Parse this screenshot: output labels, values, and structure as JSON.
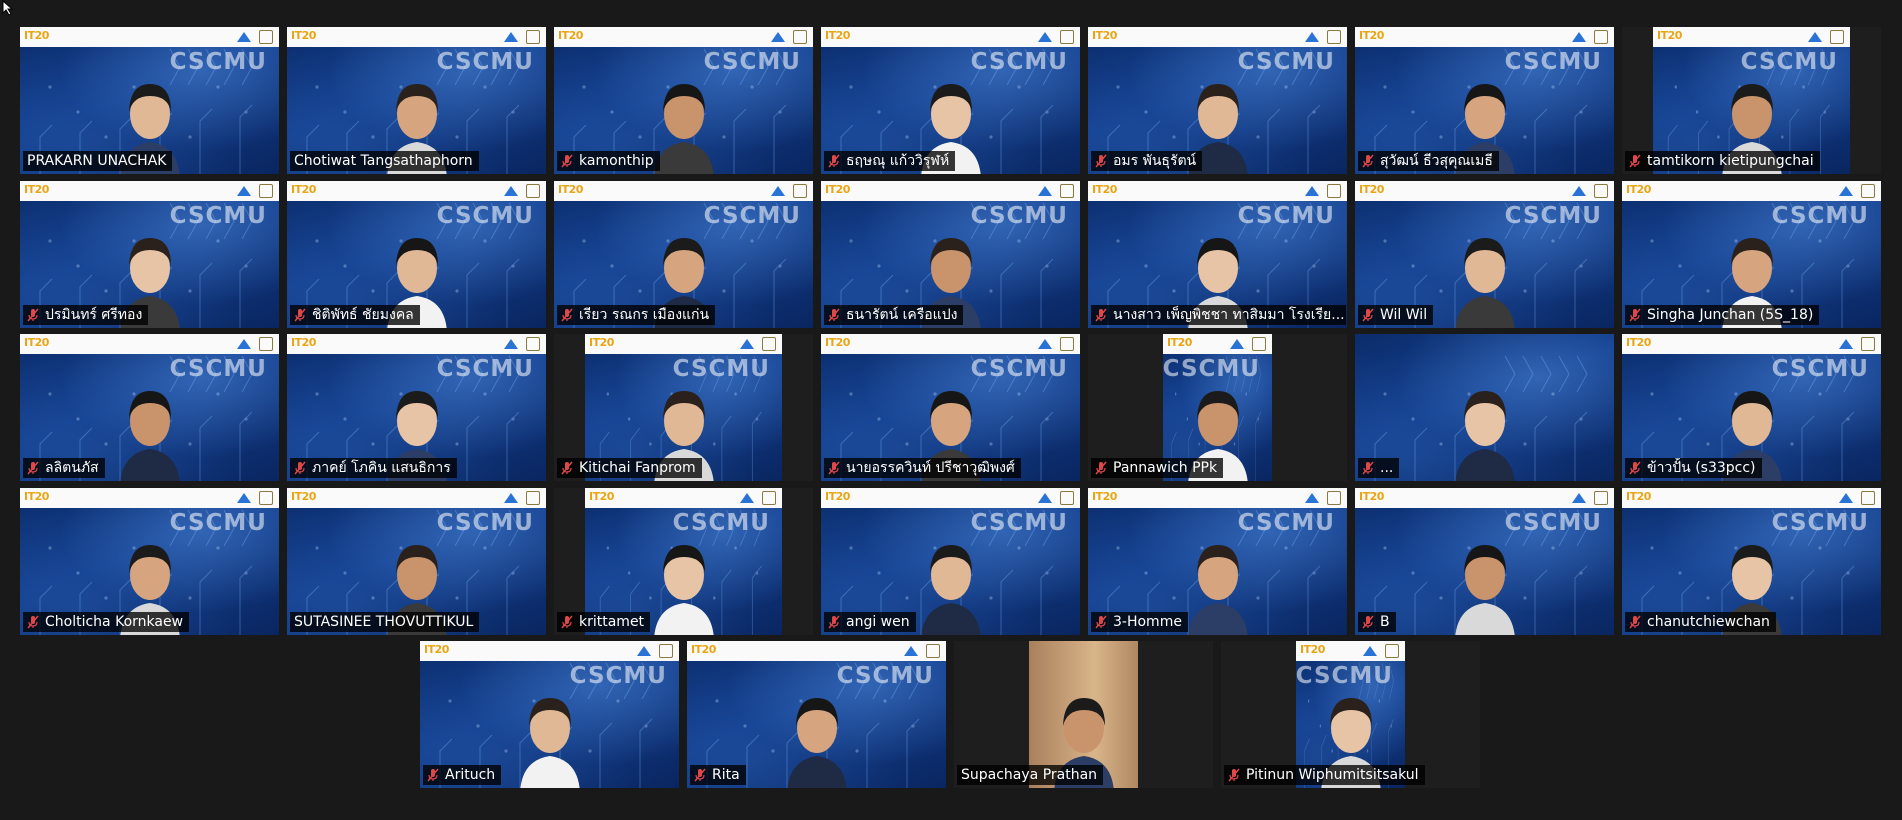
{
  "branding": {
    "brand_text": "IT20",
    "watermark_text": "CSCMU",
    "colors": {
      "background": "#191919",
      "video_blue": "#103c8c",
      "banner": "#fafafa",
      "muted_icon": "#e04848",
      "label_bg": "#000000"
    }
  },
  "participants": [
    {
      "name": "PRAKARN UNACHAK",
      "muted": false,
      "layout": "full",
      "banner": true
    },
    {
      "name": "Chotiwat Tangsathaphorn",
      "muted": false,
      "layout": "full",
      "banner": true
    },
    {
      "name": "kamonthip",
      "muted": true,
      "layout": "full",
      "banner": true
    },
    {
      "name": "ธฤษณุ แก้ววิรุฬห์",
      "muted": true,
      "layout": "full",
      "banner": true
    },
    {
      "name": "อมร พันธุรัตน์",
      "muted": true,
      "layout": "full",
      "banner": true
    },
    {
      "name": "สุวัฒน์ ธีวสุคุณเมธี",
      "muted": true,
      "layout": "full",
      "banner": true
    },
    {
      "name": "tamtikorn kietipungchai",
      "muted": true,
      "layout": "narrow",
      "banner": true
    },
    {
      "name": "ปรมินทร์ ศรีทอง",
      "muted": true,
      "layout": "full",
      "banner": true
    },
    {
      "name": "ชิติพัทธ์ ชัยมงคล",
      "muted": true,
      "layout": "full",
      "banner": true
    },
    {
      "name": "เรียว รณกร เมืองแก่น",
      "muted": true,
      "layout": "full",
      "banner": true
    },
    {
      "name": "ธนารัตน์ เครือแปง",
      "muted": true,
      "layout": "full",
      "banner": true
    },
    {
      "name": "นางสาว เพ็ญพิชชา ทาสิมมา โรงเรีย...",
      "muted": true,
      "layout": "full",
      "banner": true
    },
    {
      "name": "Wil Wil",
      "muted": true,
      "layout": "full",
      "banner": true
    },
    {
      "name": "Singha Junchan (5S_18)",
      "muted": true,
      "layout": "full",
      "banner": true
    },
    {
      "name": "ลลิตนภัส",
      "muted": true,
      "layout": "full",
      "banner": true
    },
    {
      "name": "ภาคย์ โภคิน แสนธิการ",
      "muted": true,
      "layout": "full",
      "banner": true
    },
    {
      "name": "Kitichai Fanprom",
      "muted": true,
      "layout": "narrow",
      "banner": true
    },
    {
      "name": "นายอรรควินท์ ปรีชาวุฒิพงศ์",
      "muted": true,
      "layout": "full",
      "banner": true
    },
    {
      "name": "Pannawich PPk",
      "muted": true,
      "layout": "narrow2",
      "banner": true
    },
    {
      "name": "...",
      "muted": true,
      "layout": "full",
      "banner": false
    },
    {
      "name": "ข้าวปั้น (s33pcc)",
      "muted": true,
      "layout": "full",
      "banner": true
    },
    {
      "name": "Cholticha Kornkaew",
      "muted": true,
      "layout": "full",
      "banner": true
    },
    {
      "name": "SUTASINEE THOVUTTIKUL",
      "muted": false,
      "layout": "full",
      "banner": true
    },
    {
      "name": "krittamet",
      "muted": true,
      "layout": "narrow",
      "banner": true
    },
    {
      "name": "angi wen",
      "muted": true,
      "layout": "full",
      "banner": true
    },
    {
      "name": "3-Homme",
      "muted": true,
      "layout": "full",
      "banner": true
    },
    {
      "name": "B",
      "muted": true,
      "layout": "full",
      "banner": true
    },
    {
      "name": "chanutchiewchan",
      "muted": true,
      "layout": "full",
      "banner": true
    },
    {
      "name": "Arituch",
      "muted": true,
      "layout": "full",
      "banner": true
    },
    {
      "name": "Rita",
      "muted": true,
      "layout": "full",
      "banner": true
    },
    {
      "name": "Supachaya Prathan",
      "muted": false,
      "layout": "room",
      "banner": false
    },
    {
      "name": "Pitinun Wiphumitsitsakul",
      "muted": true,
      "layout": "narrow2",
      "banner": true
    }
  ]
}
